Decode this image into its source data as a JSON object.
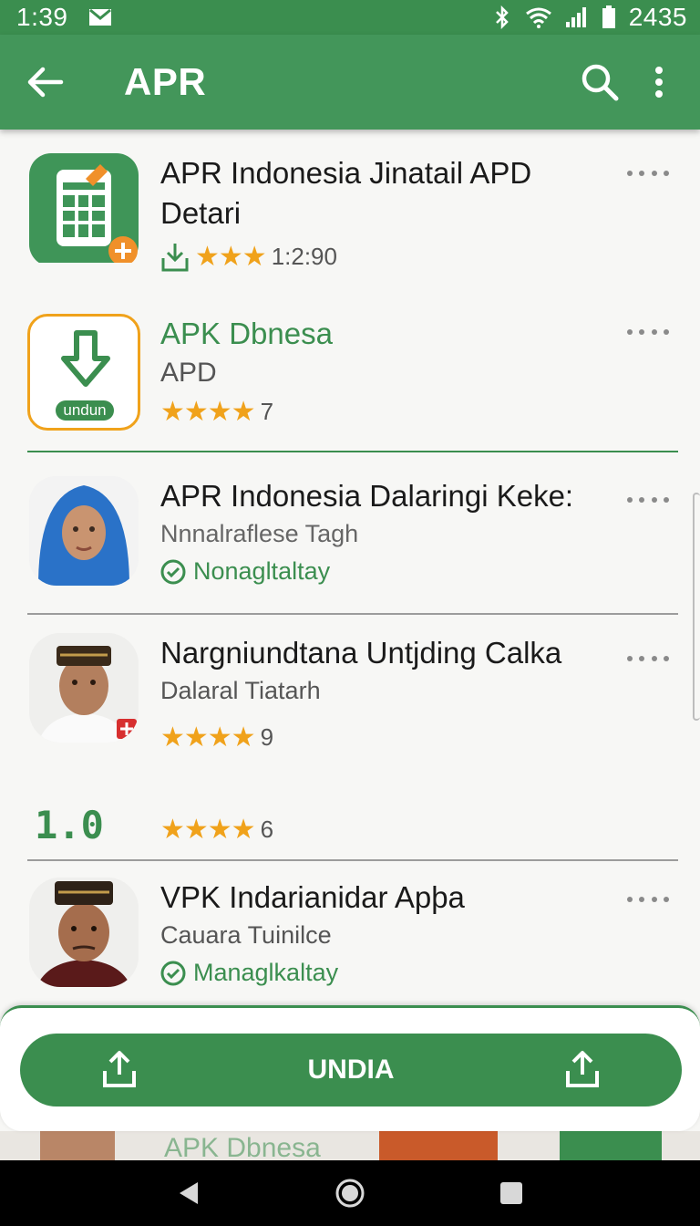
{
  "status": {
    "time": "1:39",
    "battery": "2435"
  },
  "appbar": {
    "title": "APR"
  },
  "items": [
    {
      "name": "APR Indonesia Jinatail APD Detari",
      "rating_text": "1:2:90",
      "stars": "★★★"
    },
    {
      "name": "APK Dbnesa",
      "sub": "APD",
      "stars": "★★★★",
      "count": "7",
      "badge": "undun"
    },
    {
      "name": "APR Indonesia Dalaringi Keke:",
      "sub": "Nnnalraflese Tagh",
      "verified": "Nonagltaltay"
    },
    {
      "name": "Nargniundtana Untjding Calka",
      "sub": "Dalaral Tiatarh",
      "stars": "★★★★",
      "count": "9"
    },
    {
      "big_number": "1.0",
      "stars": "★★★★",
      "count": "6"
    },
    {
      "name": "VPK Indarianidar Apþa",
      "sub": "Cauara Tuinilce",
      "verified": "Managlkaltay"
    }
  ],
  "cta": {
    "label": "UNDIA"
  },
  "peek": {
    "text": "APK Dbnesa"
  },
  "colors": {
    "primary": "#3b8e4f",
    "star": "#f0a21b",
    "accent": "#f0902a"
  }
}
